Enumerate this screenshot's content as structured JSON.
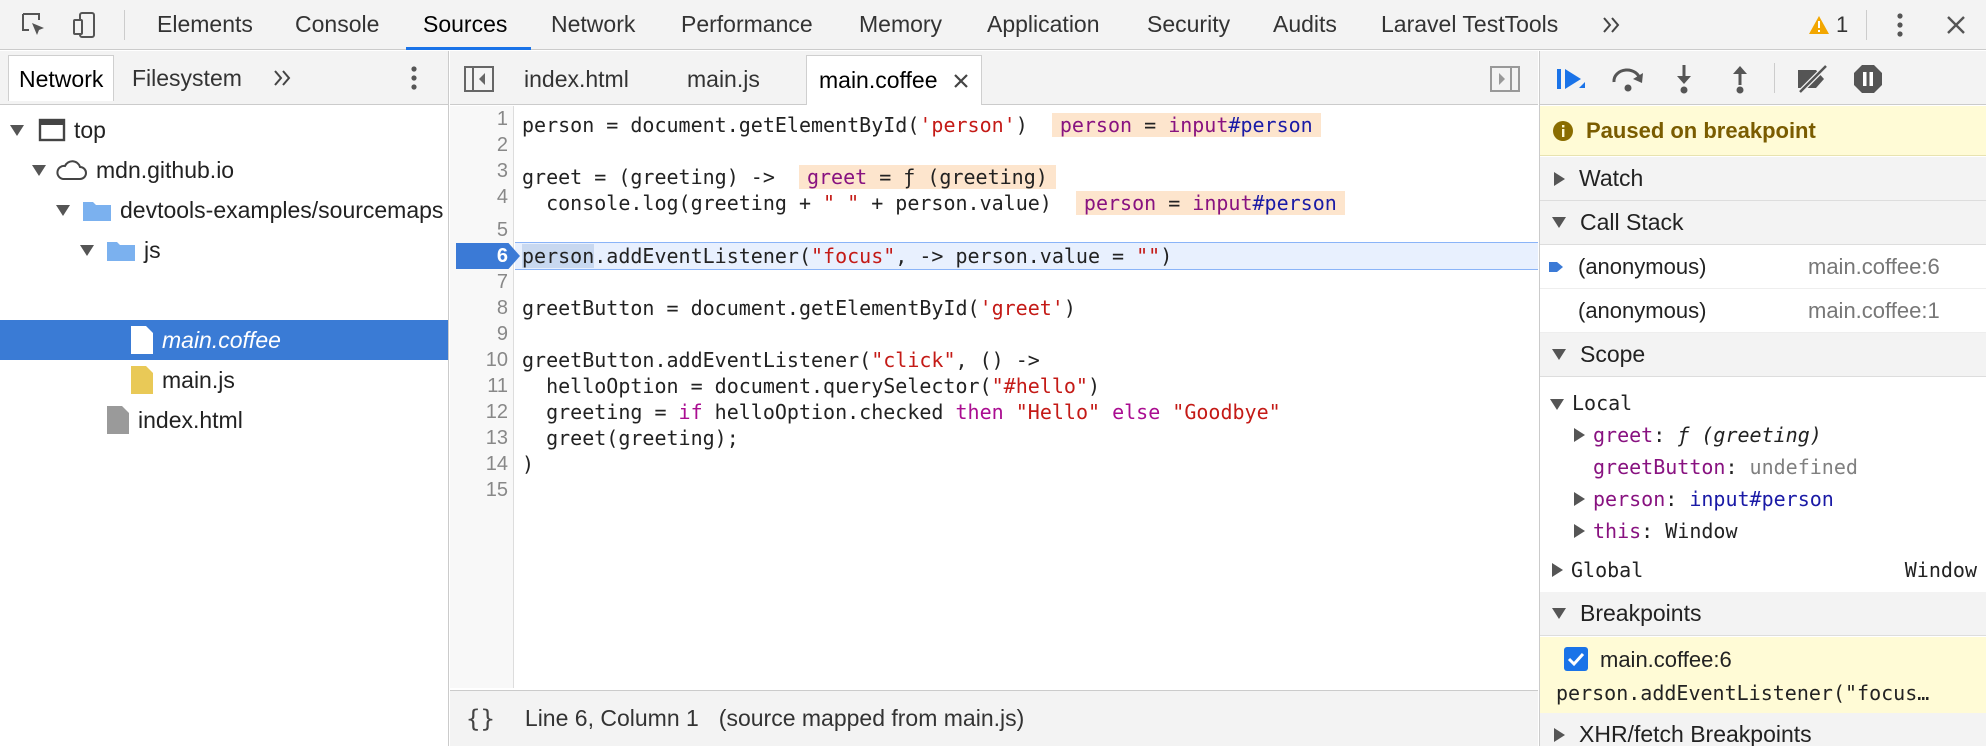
{
  "toolbar": {
    "tabs": [
      "Elements",
      "Console",
      "Sources",
      "Network",
      "Performance",
      "Memory",
      "Application",
      "Security",
      "Audits",
      "Laravel TestTools"
    ],
    "warning_count": "1"
  },
  "navigator": {
    "tabs": [
      "Network",
      "Filesystem"
    ],
    "tree": [
      "top",
      "mdn.github.io",
      "devtools-examples/sourcemaps",
      "js",
      "main.coffee",
      "main.js",
      "index.html"
    ]
  },
  "editor": {
    "tabs": [
      "index.html",
      "main.js",
      "main.coffee"
    ],
    "line_numbers": [
      "1",
      "2",
      "3",
      "4",
      "5",
      "6",
      "7",
      "8",
      "9",
      "10",
      "11",
      "12",
      "13",
      "14",
      "15"
    ],
    "breakpoint_line": "6",
    "inline_values": {
      "l1": "person = input#person",
      "l3": "greet = ƒ (greeting)",
      "l4": "person = input#person"
    },
    "status": {
      "position": "Line 6, Column 1",
      "source": "(source mapped from main.js)"
    }
  },
  "debugger": {
    "paused_text": "Paused on breakpoint",
    "sections": {
      "watch": "Watch",
      "call_stack": "Call Stack",
      "scope": "Scope",
      "breakpoints": "Breakpoints",
      "xhr": "XHR/fetch Breakpoints"
    },
    "call_stack": [
      {
        "fn": "(anonymous)",
        "loc": "main.coffee:6"
      },
      {
        "fn": "(anonymous)",
        "loc": "main.coffee:1"
      }
    ],
    "scope": {
      "local_label": "Local",
      "global_label": "Global",
      "global_value": "Window",
      "vars": [
        {
          "name": "greet",
          "value": "ƒ (greeting)"
        },
        {
          "name": "greetButton",
          "value": "undefined"
        },
        {
          "name": "person",
          "value": "input#person"
        },
        {
          "name": "this",
          "value": "Window"
        }
      ]
    },
    "breakpoint": {
      "label": "main.coffee:6",
      "code": "person.addEventListener(\"focus…"
    }
  }
}
